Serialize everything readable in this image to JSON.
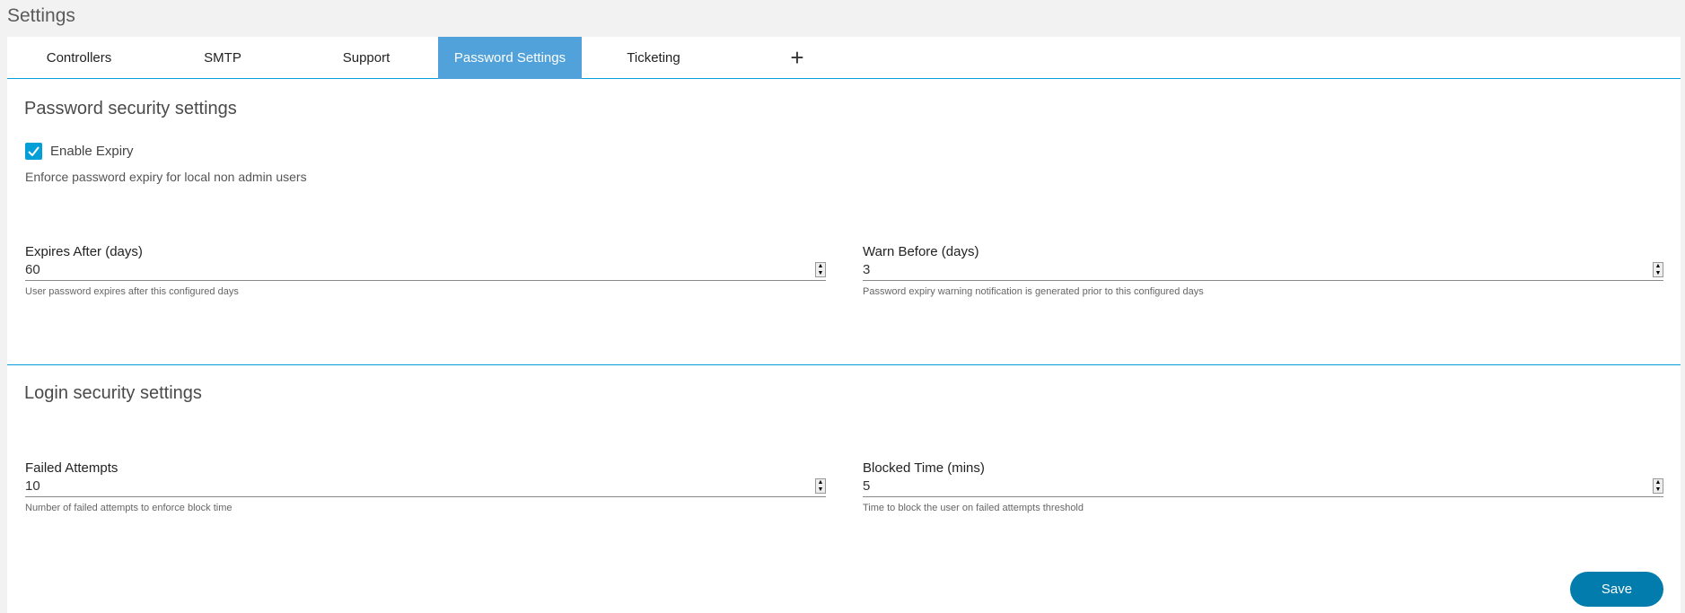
{
  "page_title": "Settings",
  "tabs": [
    {
      "label": "Controllers"
    },
    {
      "label": "SMTP"
    },
    {
      "label": "Support"
    },
    {
      "label": "Password Settings",
      "active": true
    },
    {
      "label": "Ticketing"
    },
    {
      "label": "+"
    }
  ],
  "password_section": {
    "title": "Password security settings",
    "enable_expiry": {
      "label": "Enable Expiry",
      "checked": true
    },
    "description": "Enforce password expiry for local non admin users",
    "expires_after": {
      "label": "Expires After (days)",
      "value": "60",
      "help": "User password expires after this configured days"
    },
    "warn_before": {
      "label": "Warn Before (days)",
      "value": "3",
      "help": "Password expiry warning notification is generated prior to this configured days"
    }
  },
  "login_section": {
    "title": "Login security settings",
    "failed_attempts": {
      "label": "Failed Attempts",
      "value": "10",
      "help": "Number of failed attempts to enforce block time"
    },
    "blocked_time": {
      "label": "Blocked Time (mins)",
      "value": "5",
      "help": "Time to block the user on failed attempts threshold"
    }
  },
  "save_label": "Save"
}
